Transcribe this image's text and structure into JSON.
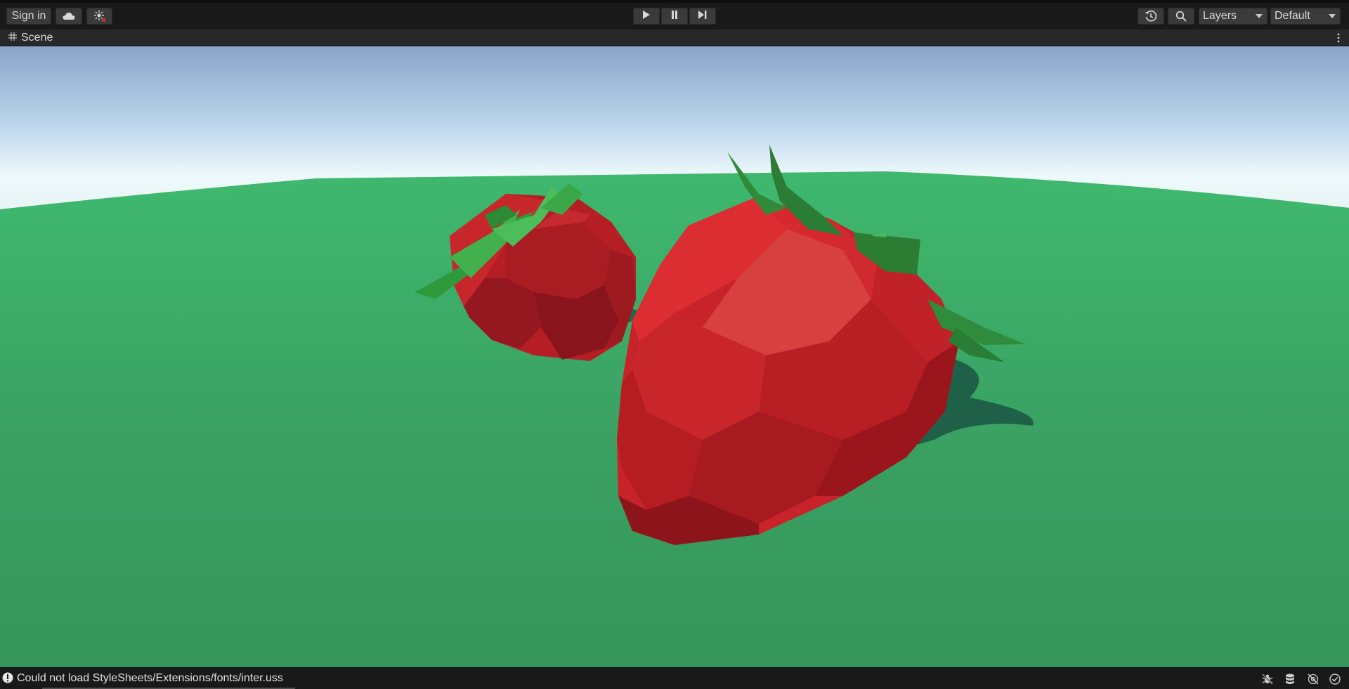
{
  "toolbar": {
    "sign_in_label": "Sign in",
    "cloud_icon": "cloud-icon",
    "collab_icon": "collab-sparkle-icon",
    "play_icon": "play-icon",
    "pause_icon": "pause-icon",
    "step_icon": "step-icon",
    "history_icon": "history-icon",
    "search_icon": "search-icon",
    "layers_label": "Layers",
    "layout_label": "Default"
  },
  "scene_tab": {
    "label": "Scene",
    "icon": "grid-icon",
    "menu_icon": "vertical-ellipsis-icon"
  },
  "viewport": {
    "content": "3D scene: two low-poly strawberries on green ground plane under sky gradient",
    "colors": {
      "sky_top": "#8ba6cc",
      "sky_horizon": "#e8f6f8",
      "ground": "#3a9a5e",
      "strawberry": "#d8262a",
      "leaves": "#3aa04a"
    }
  },
  "statusbar": {
    "message": "Could not load StyleSheets/Extensions/fonts/inter.uss",
    "warning_icon": "warning-icon",
    "right_icons": [
      "bug-icon",
      "cache-server-icon",
      "network-off-icon",
      "checkmark-circle-icon"
    ]
  }
}
